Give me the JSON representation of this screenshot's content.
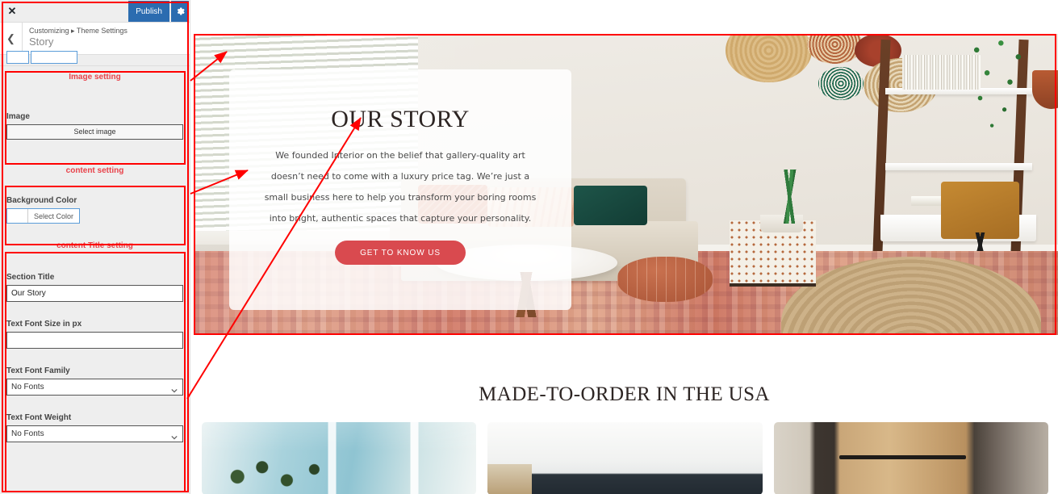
{
  "customizer": {
    "close_label": "✕",
    "publish_label": "Publish",
    "gear_icon": "gear-icon",
    "back_icon": "chevron-left-icon",
    "breadcrumb": "Customizing ▸ Theme Settings",
    "panel_title": "Story",
    "groups": [
      {
        "title": "Image setting",
        "fields": [
          {
            "label": "Image",
            "control": "button",
            "value": "Select image"
          }
        ]
      },
      {
        "title": "content setting",
        "fields": [
          {
            "label": "Background Color",
            "control": "color",
            "value": "Select Color",
            "swatch": "#ffffff"
          }
        ]
      },
      {
        "title": "content Title setting",
        "fields": [
          {
            "label": "Section Title",
            "control": "text",
            "value": "Our Story",
            "placeholder": ""
          },
          {
            "label": "Text Font Size in px",
            "control": "text",
            "value": "",
            "placeholder": ""
          },
          {
            "label": "Text Font Family",
            "control": "select",
            "value": "No Fonts"
          },
          {
            "label": "Text Font Weight",
            "control": "select",
            "value": "No Fonts"
          }
        ]
      }
    ],
    "accent_heading_color": "#e8424a",
    "publish_bg": "#2b6cb0"
  },
  "preview": {
    "hero": {
      "title": "OUR STORY",
      "paragraph": "We founded Interior on the belief that gallery-quality art doesn’t need to come with a luxury price tag. We’re just a small business here to help you transform your boring rooms into bright, authentic spaces that capture your personality.",
      "cta_label": "GET TO KNOW US",
      "cta_color": "#d94a4f",
      "highlight_color": "#f3d7d7",
      "card_bg": "rgba(255,255,255,0.86)"
    },
    "band": {
      "title": "MADE-TO-ORDER IN THE USA",
      "highlight_color": "#f6dcdc",
      "thumbnails": [
        {
          "name": "plants-by-window-photo"
        },
        {
          "name": "ceiling-corner-photo"
        },
        {
          "name": "wood-door-photo"
        }
      ]
    }
  },
  "annotation": {
    "color": "#ff0000"
  }
}
